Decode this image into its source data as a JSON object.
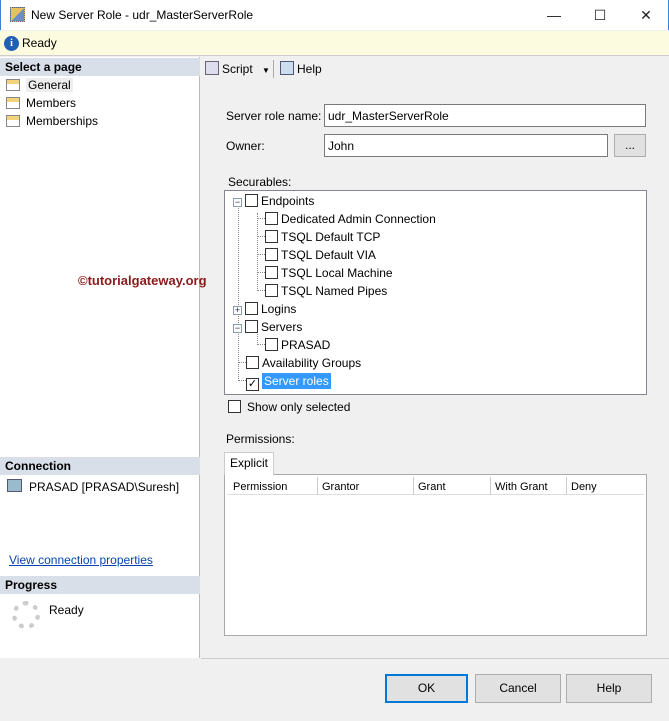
{
  "window": {
    "title": "New Server Role - udr_MasterServerRole",
    "minimize": "—",
    "maximize": "☐",
    "close": "✕"
  },
  "status": {
    "text": "Ready"
  },
  "left": {
    "select_header": "Select a page",
    "pages": [
      {
        "label": "General"
      },
      {
        "label": "Members"
      },
      {
        "label": "Memberships"
      }
    ],
    "connection_header": "Connection",
    "connection": "PRASAD [PRASAD\\Suresh]",
    "view_connection": "View connection properties",
    "progress_header": "Progress",
    "progress_status": "Ready"
  },
  "watermark": "©tutorialgateway.org",
  "toolbar": {
    "script": "Script",
    "help": "Help"
  },
  "form": {
    "role_name_label": "Server role name:",
    "role_name_value": "udr_MasterServerRole",
    "owner_label": "Owner:",
    "owner_value": "John",
    "browse": "...",
    "securables_label": "Securables:",
    "show_only_selected": "Show only selected",
    "permissions_label": "Permissions:",
    "tab": "Explicit",
    "columns": [
      "Permission",
      "Grantor",
      "Grant",
      "With Grant",
      "Deny"
    ]
  },
  "tree": [
    {
      "label": "Endpoints",
      "checked": false,
      "expander": "−"
    },
    {
      "label": "Dedicated Admin Connection",
      "checked": false
    },
    {
      "label": "TSQL Default TCP",
      "checked": false
    },
    {
      "label": "TSQL Default VIA",
      "checked": false
    },
    {
      "label": "TSQL Local Machine",
      "checked": false
    },
    {
      "label": "TSQL Named Pipes",
      "checked": false
    },
    {
      "label": "Logins",
      "checked": false,
      "expander": "+"
    },
    {
      "label": "Servers",
      "checked": false,
      "expander": "−"
    },
    {
      "label": "PRASAD",
      "checked": false
    },
    {
      "label": "Availability Groups",
      "checked": false
    },
    {
      "label": "Server roles",
      "checked": true
    }
  ],
  "buttons": {
    "ok": "OK",
    "cancel": "Cancel",
    "help": "Help"
  }
}
